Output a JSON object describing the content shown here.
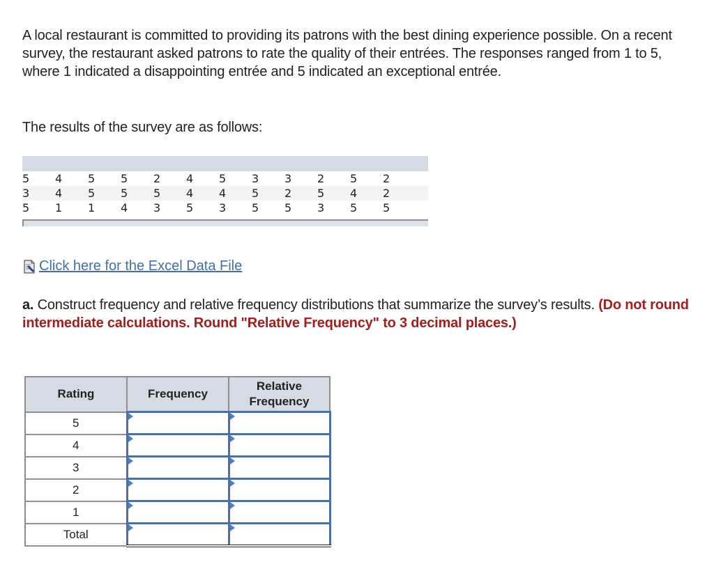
{
  "intro": {
    "paragraph": "A local restaurant is committed to providing its patrons with the best dining experience possible. On a recent survey, the restaurant asked patrons to rate the quality of their entrées. The responses ranged from 1 to 5, where 1 indicated a disappointing entrée and 5 indicated an exceptional entrée.",
    "results_label": "The results of the survey are as follows:"
  },
  "survey_data": {
    "rows": [
      [
        "5",
        "4",
        "5",
        "5",
        "2",
        "4",
        "5",
        "3",
        "3",
        "2",
        "5",
        "2"
      ],
      [
        "3",
        "4",
        "5",
        "5",
        "5",
        "4",
        "4",
        "5",
        "2",
        "5",
        "4",
        "2"
      ],
      [
        "5",
        "1",
        "1",
        "4",
        "3",
        "5",
        "3",
        "5",
        "5",
        "3",
        "5",
        "5"
      ]
    ]
  },
  "excel_link": {
    "icon": "excel-file-icon",
    "label": "Click here for the Excel Data File"
  },
  "part_a": {
    "label": "a.",
    "text": " Construct frequency and relative frequency distributions that summarize the survey’s results. ",
    "instruction": "(Do not round intermediate calculations. Round \"Relative Frequency\" to 3 decimal places.)"
  },
  "freq_table": {
    "headers": {
      "rating": "Rating",
      "frequency": "Frequency",
      "relative_frequency_line1": "Relative",
      "relative_frequency_line2": "Frequency"
    },
    "rows": [
      {
        "rating": "5",
        "frequency": "",
        "relative_frequency": ""
      },
      {
        "rating": "4",
        "frequency": "",
        "relative_frequency": ""
      },
      {
        "rating": "3",
        "frequency": "",
        "relative_frequency": ""
      },
      {
        "rating": "2",
        "frequency": "",
        "relative_frequency": ""
      },
      {
        "rating": "1",
        "frequency": "",
        "relative_frequency": ""
      }
    ],
    "total_label": "Total",
    "total_frequency": "",
    "total_relative_frequency": ""
  }
}
